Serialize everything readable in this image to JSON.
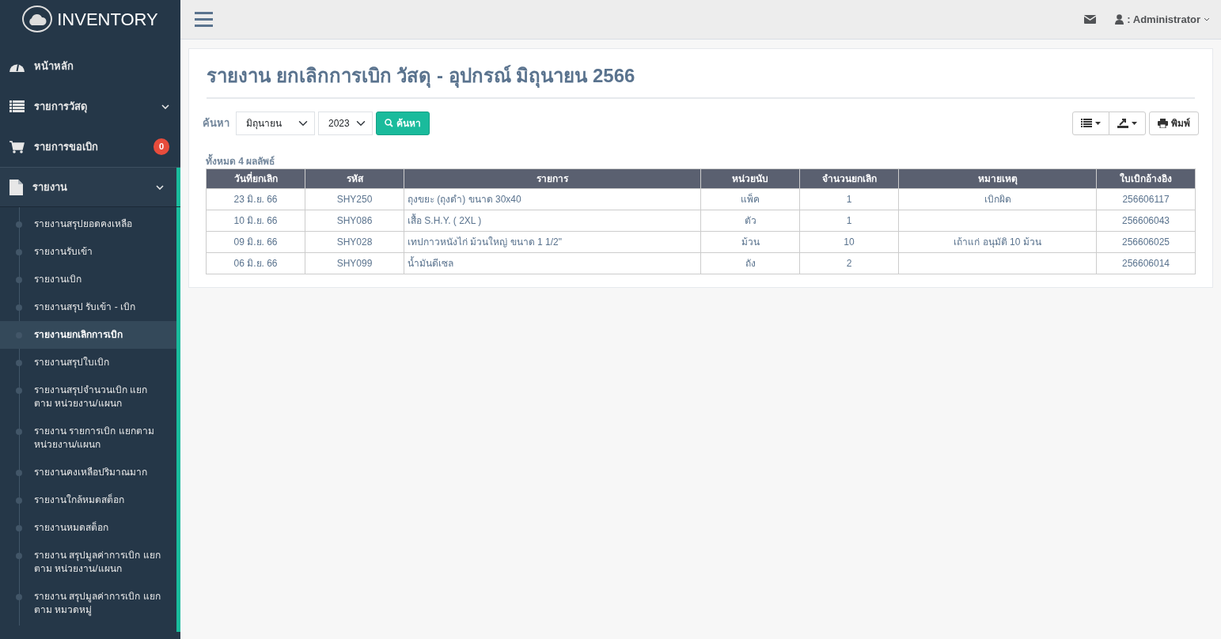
{
  "brand": "INVENTORY",
  "menu": [
    {
      "label": "หน้าหลัก",
      "expanded": false
    },
    {
      "label": "รายการวัสดุ",
      "expanded": false,
      "has_caret": true
    },
    {
      "label": "รายการขอเบิก",
      "expanded": false,
      "badge": "0"
    },
    {
      "label": "รายงาน",
      "expanded": true,
      "has_caret": true,
      "children": [
        {
          "label": "รายงานสรุปยอดคงเหลือ",
          "selected": false
        },
        {
          "label": "รายงานรับเข้า",
          "selected": false
        },
        {
          "label": "รายงานเบิก",
          "selected": false
        },
        {
          "label": "รายงานสรุป รับเข้า - เบิก",
          "selected": false
        },
        {
          "label": "รายงานยกเลิกการเบิก",
          "selected": true
        },
        {
          "label": "รายงานสรุปใบเบิก",
          "selected": false
        },
        {
          "label": "รายงานสรุปจำนวนเบิก แยกตาม หน่วยงาน/แผนก",
          "selected": false
        },
        {
          "label": "รายงาน รายการเบิก แยกตาม หน่วยงาน/แผนก",
          "selected": false
        },
        {
          "label": "รายงานคงเหลือปริมาณมาก",
          "selected": false
        },
        {
          "label": "รายงานใกล้หมดสต็อก",
          "selected": false
        },
        {
          "label": "รายงานหมดสต็อก",
          "selected": false
        },
        {
          "label": "รายงาน สรุปมูลค่าการเบิก แยก ตาม หน่วยงาน/แผนก",
          "selected": false
        },
        {
          "label": "รายงาน สรุปมูลค่าการเบิก แยก ตาม หมวดหมู่",
          "selected": false
        }
      ]
    }
  ],
  "topbar": {
    "user": ": Administrator"
  },
  "page": {
    "title": "รายงาน ยกเลิกการเบิก วัสดุ - อุปกรณ์ มิถุนายน 2566",
    "search_label": "ค้นหา",
    "month": "มิถุนายน",
    "year": "2023",
    "search_button": "ค้นหา",
    "print_button": "พิมพ์",
    "result_count": "ทั้งหมด 4 ผลลัพธ์"
  },
  "table": {
    "columns": [
      "วันที่ยกเลิก",
      "รหัส",
      "รายการ",
      "หน่วยนับ",
      "จำนวนยกเลิก",
      "หมายเหตุ",
      "ใบเบิกอ้างอิง"
    ],
    "rows": [
      [
        "23 มิ.ย. 66",
        "SHY250",
        "ถุงขยะ (ถุงดำ) ขนาด 30x40",
        "แพ็ค",
        "1",
        "เบิกผิด",
        "256606117"
      ],
      [
        "10 มิ.ย. 66",
        "SHY086",
        "เสื้อ S.H.Y. ( 2XL )",
        "ตัว",
        "1",
        "",
        "256606043"
      ],
      [
        "09 มิ.ย. 66",
        "SHY028",
        "เทปกาวหนังไก่ ม้วนใหญ่ ขนาด 1 1/2\"",
        "ม้วน",
        "10",
        "เถ้าแก่ อนุมัติ 10 ม้วน",
        "256606025"
      ],
      [
        "06 มิ.ย. 66",
        "SHY099",
        "น้ำมันดีเซล",
        "ถัง",
        "2",
        "",
        "256606014"
      ]
    ]
  }
}
